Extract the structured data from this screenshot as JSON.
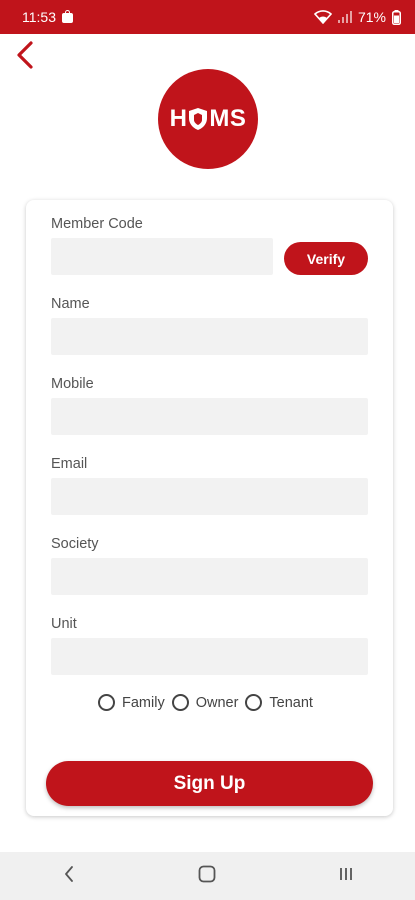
{
  "status_bar": {
    "time": "11:53",
    "battery": "71%"
  },
  "logo": {
    "text_left": "H",
    "text_right": "MS"
  },
  "form": {
    "fields": [
      {
        "label": "Member Code",
        "value": "",
        "placeholder": ""
      },
      {
        "label": "Name",
        "value": "",
        "placeholder": ""
      },
      {
        "label": "Mobile",
        "value": "",
        "placeholder": ""
      },
      {
        "label": "Email",
        "value": "",
        "placeholder": ""
      },
      {
        "label": "Society",
        "value": "",
        "placeholder": ""
      },
      {
        "label": "Unit",
        "value": "",
        "placeholder": ""
      }
    ],
    "verify_label": "Verify",
    "radio_options": [
      "Family",
      "Owner",
      "Tenant"
    ],
    "signup_label": "Sign Up"
  },
  "colors": {
    "brand_red": "#c0141b",
    "input_bg": "#f2f2f2",
    "nav_bg": "#f0f0f0"
  },
  "icons": {
    "back": "chevron-left-icon",
    "nav_back": "nav-back-icon",
    "nav_home": "nav-home-icon",
    "nav_recents": "nav-recents-icon"
  }
}
